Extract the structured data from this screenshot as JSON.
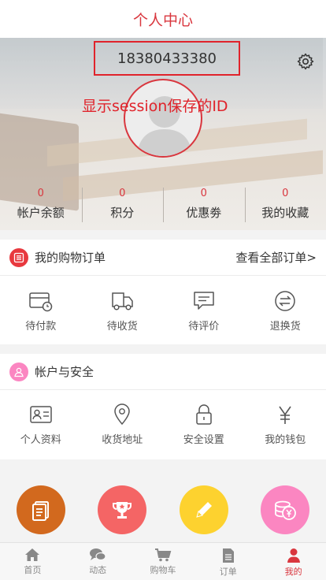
{
  "header": {
    "title": "个人中心"
  },
  "profile": {
    "user_id": "18380433380",
    "annotation": "显示session保存的ID"
  },
  "stats": [
    {
      "value": "0",
      "label": "帐户余额"
    },
    {
      "value": "0",
      "label": "积分"
    },
    {
      "value": "0",
      "label": "优惠劵"
    },
    {
      "value": "0",
      "label": "我的收藏"
    }
  ],
  "orders": {
    "title": "我的购物订单",
    "link": "查看全部订单>",
    "items": [
      {
        "label": "待付款",
        "icon": "wallet-clock-icon"
      },
      {
        "label": "待收货",
        "icon": "truck-icon"
      },
      {
        "label": "待评价",
        "icon": "comment-icon"
      },
      {
        "label": "退换货",
        "icon": "exchange-icon"
      }
    ]
  },
  "account": {
    "title": "帐户与安全",
    "items": [
      {
        "label": "个人资料",
        "icon": "id-card-icon"
      },
      {
        "label": "收货地址",
        "icon": "location-pin-icon"
      },
      {
        "label": "安全设置",
        "icon": "lock-icon"
      },
      {
        "label": "我的钱包",
        "icon": "yen-icon"
      }
    ]
  },
  "shortcuts": [
    {
      "icon": "document-icon",
      "color": "#d2691e"
    },
    {
      "icon": "trophy-icon",
      "color": "#f46565"
    },
    {
      "icon": "pencil-icon",
      "color": "#fdd22f"
    },
    {
      "icon": "coins-icon",
      "color": "#fb86c1"
    }
  ],
  "tabbar": {
    "items": [
      {
        "label": "首页",
        "icon": "home-icon"
      },
      {
        "label": "动态",
        "icon": "chat-icon"
      },
      {
        "label": "购物车",
        "icon": "cart-icon"
      },
      {
        "label": "订单",
        "icon": "order-icon"
      },
      {
        "label": "我的",
        "icon": "user-icon"
      }
    ],
    "active_index": 4
  },
  "colors": {
    "accent": "#d9363e",
    "annotation": "#e0232b"
  }
}
